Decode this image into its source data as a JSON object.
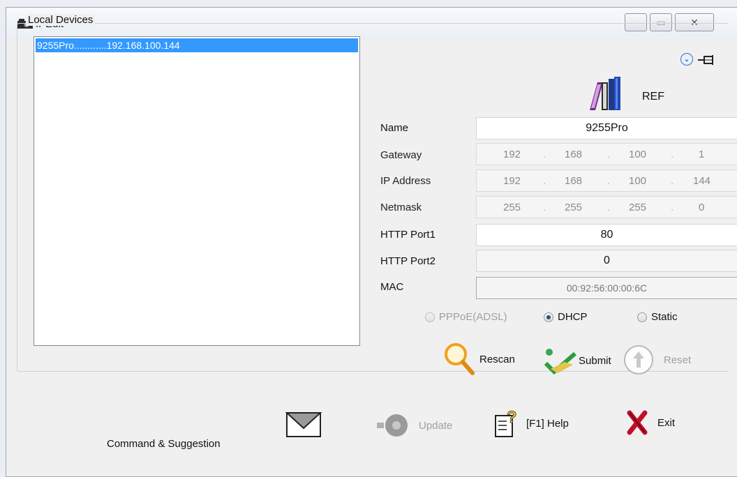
{
  "window": {
    "title": "IPEdit",
    "minimize_glyph": "—",
    "maximize_glyph": "▭",
    "close_glyph": "✕"
  },
  "devices": {
    "group_title": "Local Devices",
    "items": [
      {
        "label": "9255Pro............192.168.100.144"
      }
    ]
  },
  "ref": {
    "label": "REF"
  },
  "fields": {
    "name": {
      "label": "Name",
      "value": "9255Pro"
    },
    "gateway": {
      "label": "Gateway",
      "octets": [
        "192",
        "168",
        "100",
        "1"
      ]
    },
    "ip_address": {
      "label": "IP Address",
      "octets": [
        "192",
        "168",
        "100",
        "144"
      ]
    },
    "netmask": {
      "label": "Netmask",
      "octets": [
        "255",
        "255",
        "255",
        "0"
      ]
    },
    "http_port1": {
      "label": "HTTP Port1",
      "value": "80"
    },
    "http_port2": {
      "label": "HTTP Port2",
      "value": "0"
    },
    "mac": {
      "label": "MAC",
      "value": "00:92:56:00:00:6C"
    }
  },
  "mode": {
    "options": [
      "PPPoE(ADSL)",
      "DHCP",
      "Static"
    ],
    "selected": "DHCP"
  },
  "actions": {
    "rescan": "Rescan",
    "submit": "Submit",
    "reset": "Reset"
  },
  "toolbar": {
    "update": "Update",
    "help": "[F1] Help",
    "exit": "Exit"
  },
  "footer": {
    "command_label": "Command & Suggestion"
  },
  "colors": {
    "selection": "#3399ff",
    "exit_icon": "#c0102a"
  }
}
